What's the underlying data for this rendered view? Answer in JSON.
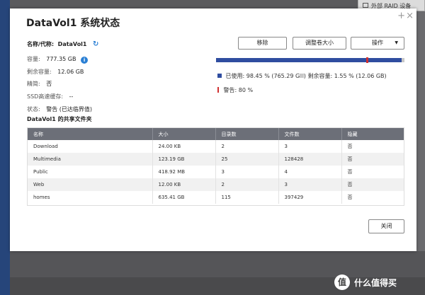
{
  "background": {
    "raid_button": "外部 RAID 设备"
  },
  "dialog": {
    "title": "DataVol1  系统状态",
    "window_controls": {
      "plus": "+",
      "close": "×"
    },
    "info": {
      "name_label": "名称/代称:",
      "name_value": "DataVol1",
      "capacity_label": "容量:",
      "capacity_value": "777.35 GB",
      "free_label": "剩余容量:",
      "free_value": "12.06 GB",
      "thin_label": "精简:",
      "thin_value": "否",
      "ssd_label": "SSD高速缓存:",
      "ssd_value": "--",
      "status_label": "状态:",
      "status_value": "警告 (已达临界值)"
    },
    "buttons": {
      "remove": "移除",
      "resize": "调整卷大小",
      "actions": "操作"
    },
    "usage": {
      "used_percent": 98.45,
      "warning_percent": 80,
      "used_legend": "已使用: 98.45 % (765.29 GB)",
      "free_legend": "剩余容量: 1.55 % (12.06 GB)",
      "warning_legend": "警告: 80 %",
      "colors": {
        "used": "#2f4da0",
        "free": "#c8c8c8",
        "warning": "#d03030"
      }
    },
    "shares": {
      "title": "DataVol1 的共享文件夹",
      "headers": [
        "名称",
        "大小",
        "目录数",
        "文件数",
        "隐藏"
      ],
      "rows": [
        [
          "Download",
          "24.00 KB",
          "2",
          "3",
          "否"
        ],
        [
          "Multimedia",
          "123.19 GB",
          "25",
          "128428",
          "否"
        ],
        [
          "Public",
          "418.92 MB",
          "3",
          "4",
          "否"
        ],
        [
          "Web",
          "12.00 KB",
          "2",
          "3",
          "否"
        ],
        [
          "homes",
          "635.41 GB",
          "115",
          "397429",
          "否"
        ]
      ]
    },
    "close_button": "关闭"
  },
  "watermark": {
    "circle": "值",
    "text": "什么值得买"
  }
}
